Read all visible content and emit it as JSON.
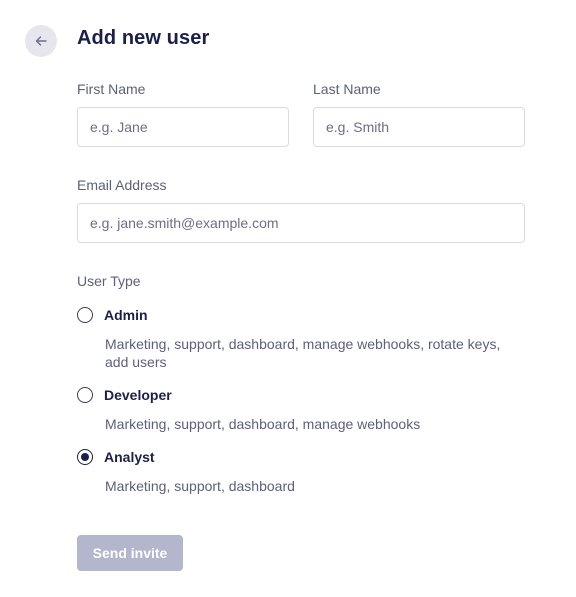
{
  "header": {
    "back_icon": "arrow-left-icon",
    "title": "Add new user"
  },
  "form": {
    "first_name": {
      "label": "First Name",
      "placeholder": "e.g. Jane",
      "value": ""
    },
    "last_name": {
      "label": "Last Name",
      "placeholder": "e.g. Smith",
      "value": ""
    },
    "email": {
      "label": "Email Address",
      "placeholder": "e.g. jane.smith@example.com",
      "value": ""
    },
    "user_type": {
      "label": "User Type",
      "selected": "Analyst",
      "options": [
        {
          "label": "Admin",
          "description": "Marketing, support, dashboard, manage webhooks, rotate keys, add users",
          "checked": false
        },
        {
          "label": "Developer",
          "description": "Marketing, support, dashboard, manage webhooks",
          "checked": false
        },
        {
          "label": "Analyst",
          "description": "Marketing, support, dashboard",
          "checked": true
        }
      ]
    },
    "submit_label": "Send invite",
    "submit_disabled": true
  },
  "colors": {
    "text_primary": "#1c1f4a",
    "text_secondary": "#5c607a",
    "button_disabled_bg": "#b3b6cc",
    "back_button_bg": "#e6e7ee",
    "input_border": "#d9dbe4"
  }
}
